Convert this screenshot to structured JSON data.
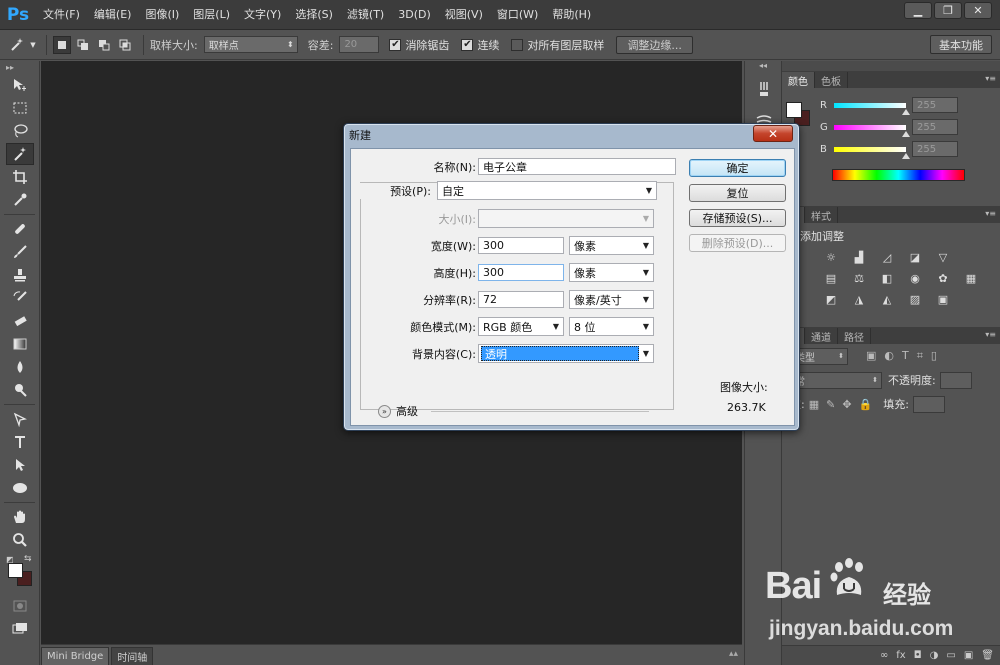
{
  "app": {
    "logo": "Ps"
  },
  "menu": [
    "文件(F)",
    "编辑(E)",
    "图像(I)",
    "图层(L)",
    "文字(Y)",
    "选择(S)",
    "滤镜(T)",
    "3D(D)",
    "视图(V)",
    "窗口(W)",
    "帮助(H)"
  ],
  "window_controls": {
    "minimize": "▁",
    "restore": "❐",
    "close": "✕"
  },
  "options_bar": {
    "sample_size_label": "取样大小:",
    "sample_size_value": "取样点",
    "tolerance_label": "容差:",
    "tolerance_value": "20",
    "anti_alias_label": "消除锯齿",
    "anti_alias_checked": true,
    "contiguous_label": "连续",
    "contiguous_checked": true,
    "all_layers_label": "对所有图层取样",
    "all_layers_checked": false,
    "refine_edge_label": "调整边缘...",
    "workspace_label": "基本功能"
  },
  "bottom_tabs": [
    "Mini Bridge",
    "时间轴"
  ],
  "color_panel": {
    "tabs": [
      "颜色",
      "色板"
    ],
    "channels": [
      {
        "label": "R",
        "value": "255",
        "color": "#00e5ff"
      },
      {
        "label": "G",
        "value": "255",
        "color": "#ff00ff"
      },
      {
        "label": "B",
        "value": "255",
        "color": "#ffff00"
      }
    ],
    "foreground": "#ffffff",
    "background": "#4a1f1f"
  },
  "adjust_panel": {
    "tabs": [
      "整",
      "样式"
    ],
    "title": "添加调整"
  },
  "layers_panel": {
    "tabs": [
      "层",
      "通道",
      "路径"
    ],
    "kind_label": "类型",
    "blend_mode": "常",
    "opacity_label": "不透明度:",
    "lock_label": "定:",
    "fill_label": "填充:",
    "bottom_icons": [
      "∞",
      "fx",
      "◘",
      "◑",
      "▭",
      "▣",
      "🗑"
    ]
  },
  "dialog": {
    "title": "新建",
    "close_label": "✕",
    "name_label": "名称(N):",
    "name_value": "电子公章",
    "preset_label": "预设(P):",
    "preset_value": "自定",
    "size_label": "大小(I):",
    "width_label": "宽度(W):",
    "width_value": "300",
    "width_unit": "像素",
    "height_label": "高度(H):",
    "height_value": "300",
    "height_unit": "像素",
    "resolution_label": "分辨率(R):",
    "resolution_value": "72",
    "resolution_unit": "像素/英寸",
    "color_mode_label": "颜色模式(M):",
    "color_mode_value": "RGB 颜色",
    "bit_depth_value": "8 位",
    "background_label": "背景内容(C):",
    "background_value": "透明",
    "advanced_label": "高级",
    "ok_label": "确定",
    "reset_label": "复位",
    "save_preset_label": "存储预设(S)...",
    "delete_preset_label": "删除预设(D)...",
    "image_size_label": "图像大小:",
    "image_size_value": "263.7K"
  },
  "watermark": {
    "logo": "Bai",
    "logo_suffix": "经验",
    "url": "jingyan.baidu.com"
  }
}
